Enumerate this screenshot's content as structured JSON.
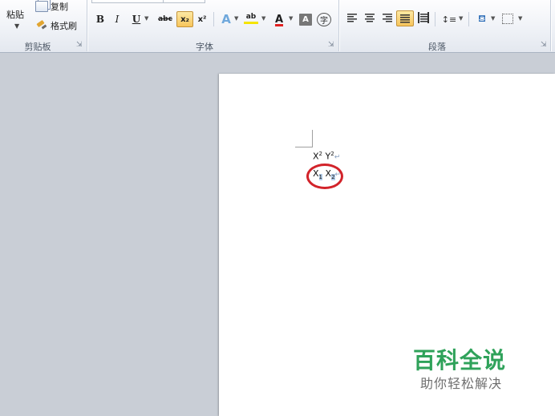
{
  "ribbon": {
    "clipboard": {
      "paste_label": "粘贴",
      "copy_label": "复制",
      "format_painter_label": "格式刷",
      "group_label": "剪贴板"
    },
    "font": {
      "bold": "B",
      "italic": "I",
      "underline": "U",
      "strikethrough": "abc",
      "subscript": "x₂",
      "superscript": "x²",
      "text_effects": "A",
      "highlight": "ab",
      "font_color": "A",
      "char_shading": "A",
      "enclose_char": "字",
      "group_label": "字体"
    },
    "paragraph": {
      "group_label": "段落"
    },
    "colors": {
      "highlight_yellow": "#f5e400",
      "font_red": "#e02020",
      "active_orange": "#f7c55b"
    }
  },
  "document": {
    "line1": {
      "base1": "X",
      "sup1": "2",
      "base2": " Y",
      "sup2": "2",
      "mark": "↵"
    },
    "line2": {
      "base1": "X",
      "sub1": "1",
      "base2": " X",
      "sub2": "2",
      "mark": "↵"
    },
    "annotation_color": "#d2232a"
  },
  "watermark": {
    "title": "百科全说",
    "subtitle": "助你轻松解决"
  }
}
